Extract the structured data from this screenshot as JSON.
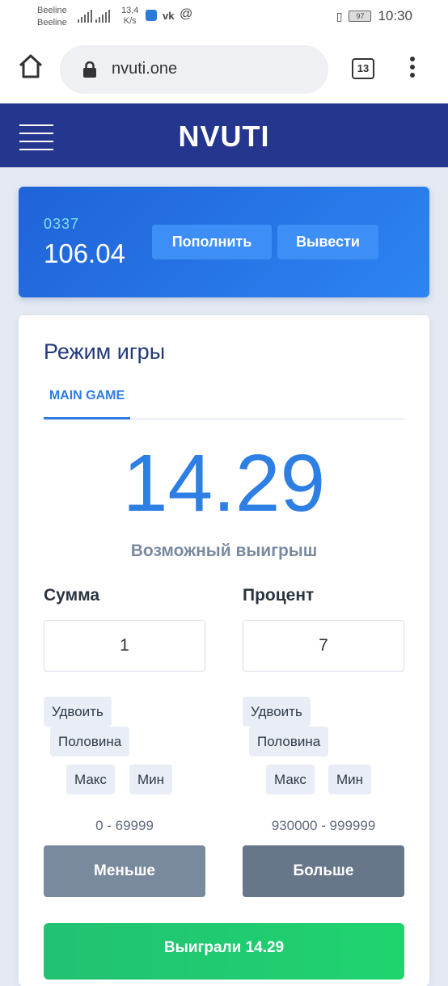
{
  "status_bar": {
    "carrier1": "Beeline",
    "carrier2": "Beeline",
    "speed_value": "13,4",
    "speed_unit": "K/s",
    "vk_icon": "vk-icon",
    "at_icon": "at-icon",
    "battery": "97",
    "time": "10:30"
  },
  "browser": {
    "url": "nvuti.one",
    "tabs_count": "13"
  },
  "app": {
    "title": "NVUTI"
  },
  "account": {
    "user_id": "0337",
    "balance": "106.04",
    "deposit_label": "Пополнить",
    "withdraw_label": "Вывести"
  },
  "game": {
    "title": "Режим игры",
    "tab_main": "MAIN GAME",
    "possible_win": "14.29",
    "possible_win_label": "Возможный выигрыш",
    "amount_label": "Сумма",
    "amount_value": "1",
    "percent_label": "Процент",
    "percent_value": "7",
    "amount_buttons": {
      "double": "Удвоить",
      "half": "Половина",
      "max": "Макс",
      "min": "Мин"
    },
    "percent_buttons": {
      "double": "Удвоить",
      "half": "Половина",
      "max": "Макс",
      "min": "Мин"
    },
    "less_range": "0 - 69999",
    "more_range": "930000 - 999999",
    "less_label": "Меньше",
    "more_label": "Больше",
    "result_label": "Выиграли 14.29"
  }
}
